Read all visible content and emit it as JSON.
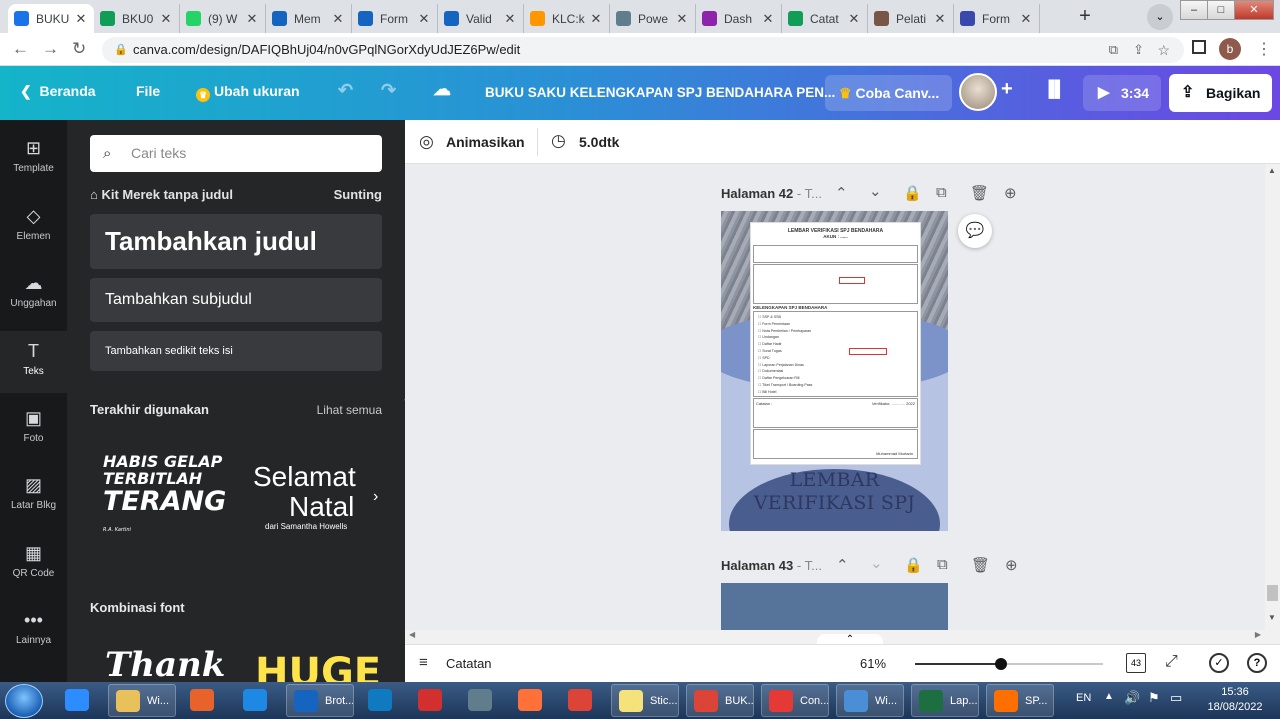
{
  "browser": {
    "tabs": [
      {
        "title": "BUKU",
        "color": "#1a73e8",
        "active": true
      },
      {
        "title": "BKU0",
        "color": "#0f9d58"
      },
      {
        "title": "(9) W",
        "color": "#25d366"
      },
      {
        "title": "Mem",
        "color": "#1565c0"
      },
      {
        "title": "Form",
        "color": "#1565c0"
      },
      {
        "title": "Valid",
        "color": "#1565c0"
      },
      {
        "title": "KLC:k",
        "color": "#ff9800"
      },
      {
        "title": "Powe",
        "color": "#607d8b"
      },
      {
        "title": "Dash",
        "color": "#8e24aa"
      },
      {
        "title": "Catat",
        "color": "#0f9d58"
      },
      {
        "title": "Pelati",
        "color": "#795548"
      },
      {
        "title": "Form",
        "color": "#3949ab"
      }
    ],
    "url": "canva.com/design/DAFIQBhUj04/n0vGPqlNGorXdyUdJEZ6Pw/edit",
    "profile_initial": "b"
  },
  "header": {
    "home": "Beranda",
    "file": "File",
    "resize": "Ubah ukuran",
    "doc_title": "BUKU SAKU KELENGKAPAN SPJ BENDAHARA PEN...",
    "try_canva": "Coba Canv...",
    "play_time": "3:34",
    "share": "Bagikan"
  },
  "rail": [
    {
      "label": "Template",
      "icon": "⊞"
    },
    {
      "label": "Elemen",
      "icon": "◇"
    },
    {
      "label": "Unggahan",
      "icon": "☁"
    },
    {
      "label": "Teks",
      "icon": "T"
    },
    {
      "label": "Foto",
      "icon": "▣"
    },
    {
      "label": "Latar Blkg",
      "icon": "▨"
    },
    {
      "label": "QR Code",
      "icon": "▦"
    },
    {
      "label": "Lainnya",
      "icon": "•••"
    }
  ],
  "panel": {
    "search_placeholder": "Cari teks",
    "brand_kit": "Kit Merek tanpa judul",
    "edit": "Sunting",
    "add_heading": "Tambahkan judul",
    "add_subheading": "Tambahkan subjudul",
    "add_body": "Tambahkan sedikit teks isi",
    "recent": "Terakhir digunakan",
    "see_all": "Lihat semua",
    "preview1": {
      "line1": "HABIS GELAP",
      "line2": "TERBITLAH",
      "line3": "TERANG",
      "credit": "R.A. Kartini"
    },
    "preview2": {
      "line1": "Selamat",
      "line2": "Natal",
      "credit": "dari Samantha Howells"
    },
    "combos": "Kombinasi font",
    "combo1": "Thank",
    "combo2": "HUGE"
  },
  "editor": {
    "animate": "Animasikan",
    "duration": "5.0dtk",
    "page42_label": "Halaman 42",
    "page42_suffix": "- T...",
    "page43_label": "Halaman 43",
    "page43_suffix": "- T...",
    "doc": {
      "title1": "LEMBAR VERIFIKASI SPJ BENDAHARA",
      "title2": "AKUN : ......",
      "section": "KELENGKAPAN SPJ BENDAHARA",
      "checklist": [
        "SSP & SSB",
        "Form Permintaan",
        "Nota Pembelian / Pembayaran",
        "Undangan",
        "Daftar Hadir",
        "Surat Tugas",
        "SPD",
        "Laporan Perjalanan Dinas",
        "Dokumentasi",
        "Daftar Pengeluaran Rill",
        "Tiket Transport / Boarding Pass",
        "Bill Hotel"
      ],
      "notes": "Catatan :",
      "verification": "Verifikator, ............ 2022",
      "signer": "Muhammad Murtado"
    },
    "page_title_line1": "LEMBAR",
    "page_title_line2": "VERIFIKASI SPJ",
    "notes_label": "Catatan",
    "zoom": "61%",
    "zoom_fraction": 0.46,
    "page_count": "43"
  },
  "taskbar": {
    "items": [
      {
        "label": "",
        "color": "#2d8cff"
      },
      {
        "label": "Wi...",
        "color": "#e8c15a"
      },
      {
        "label": "",
        "color": "#e8632b"
      },
      {
        "label": "",
        "color": "#1e88e5"
      },
      {
        "label": "Brot...",
        "color": "#1565c0"
      },
      {
        "label": "",
        "color": "#0f7ac0"
      },
      {
        "label": "",
        "color": "#d32f2f"
      },
      {
        "label": "",
        "color": "#607d8b"
      },
      {
        "label": "",
        "color": "#ff7139"
      },
      {
        "label": "",
        "color": "#db4437"
      },
      {
        "label": "Stic...",
        "color": "#f5e27a"
      },
      {
        "label": "BUK...",
        "color": "#db4437"
      },
      {
        "label": "Con...",
        "color": "#e53935"
      },
      {
        "label": "Wi...",
        "color": "#4a8fd6"
      },
      {
        "label": "Lap...",
        "color": "#1d6f42"
      },
      {
        "label": "SP...",
        "color": "#ff6f00"
      }
    ],
    "lang": "EN",
    "time": "15:36",
    "date": "18/08/2022"
  }
}
